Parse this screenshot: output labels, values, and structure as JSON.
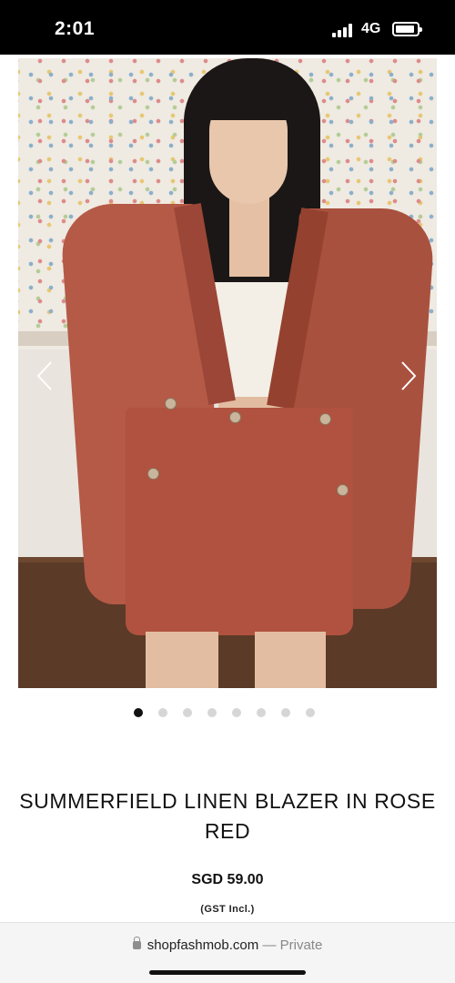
{
  "status_bar": {
    "time": "2:01",
    "network": "4G"
  },
  "product": {
    "title": "SUMMERFIELD LINEN BLAZER IN ROSE RED",
    "price": "SGD 59.00",
    "tax_note": "(GST Incl.)",
    "image_alt": "product-photo",
    "gallery": {
      "total_images": 8,
      "active_index": 0
    }
  },
  "browser": {
    "domain": "shopfashmob.com",
    "separator": "—",
    "mode": "Private"
  },
  "colors": {
    "jacket": "#b45a47",
    "active_dot": "#111111",
    "inactive_dot": "#d6d6d6"
  }
}
